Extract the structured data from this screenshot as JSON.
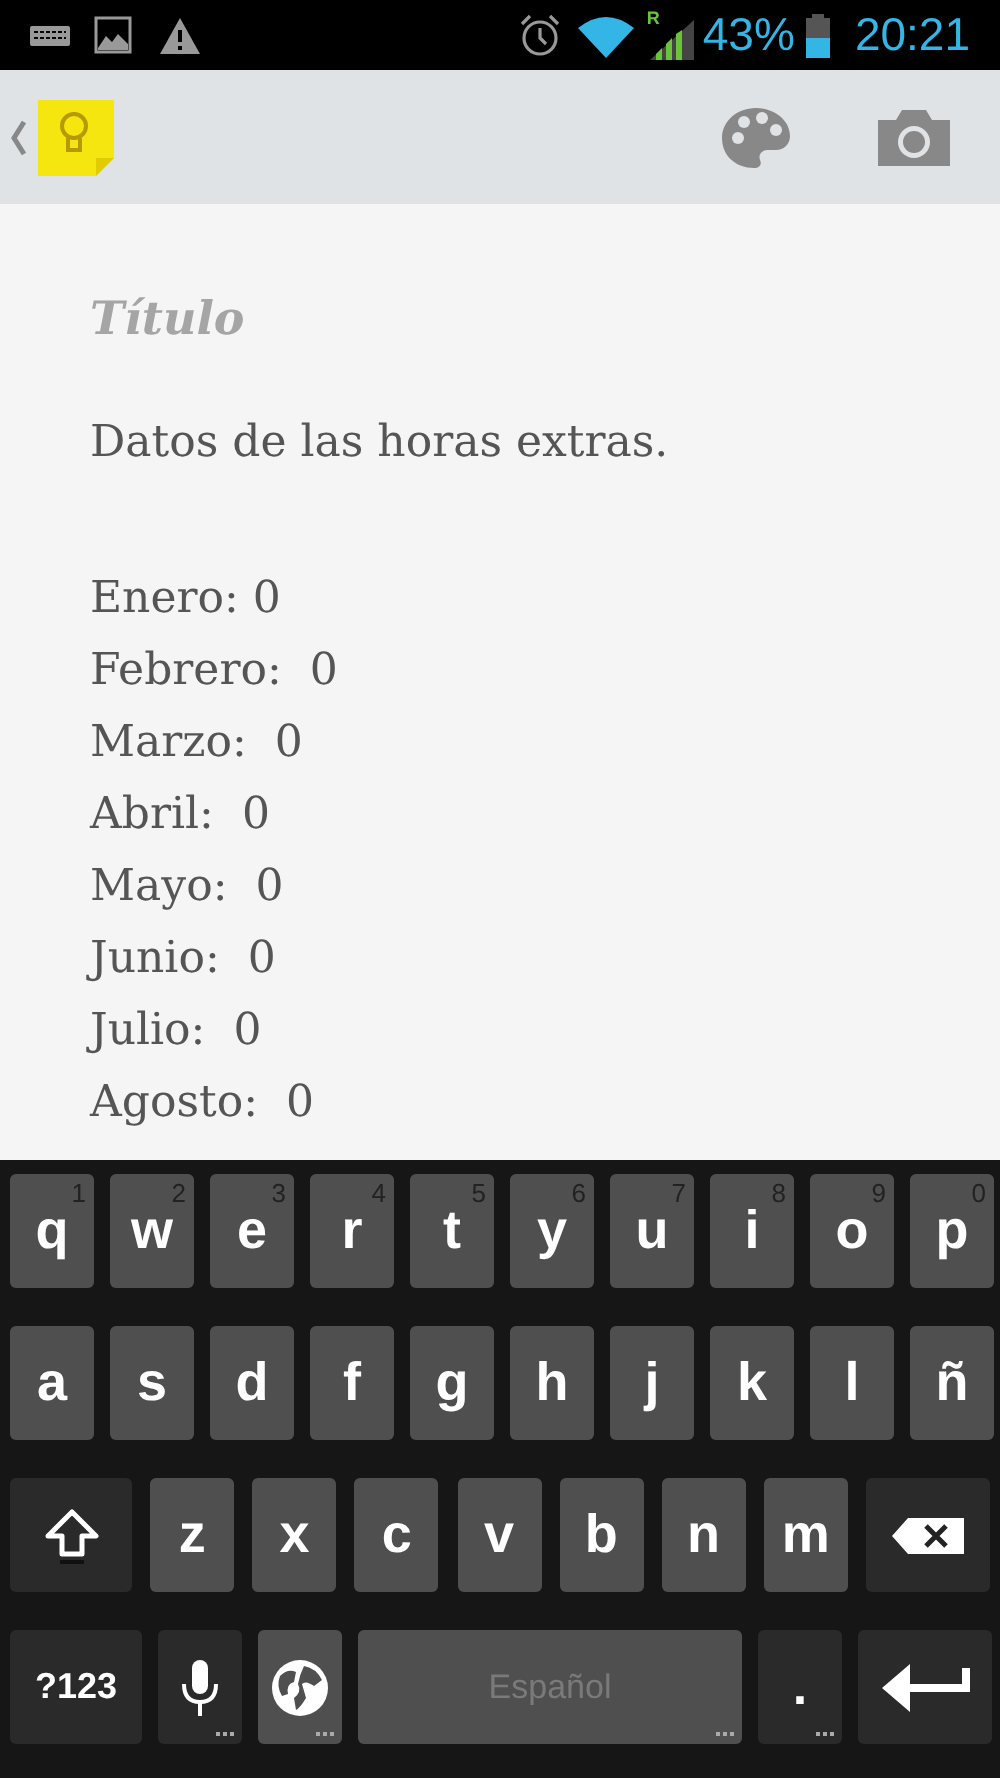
{
  "status_bar": {
    "roaming": "R",
    "battery": "43%",
    "time": "20:21"
  },
  "note": {
    "title_placeholder": "Título",
    "intro": "Datos de las horas extras.",
    "lines": [
      "Enero: 0",
      "Febrero:  0",
      "Marzo:  0",
      "Abril:  0",
      "Mayo:  0",
      "Junio:  0",
      "Julio:  0",
      "Agosto:  0"
    ]
  },
  "keyboard": {
    "key_rows": [
      [
        {
          "kind": "char",
          "label": "q",
          "hint": "1"
        },
        {
          "kind": "char",
          "label": "w",
          "hint": "2"
        },
        {
          "kind": "char",
          "label": "e",
          "hint": "3"
        },
        {
          "kind": "char",
          "label": "r",
          "hint": "4"
        },
        {
          "kind": "char",
          "label": "t",
          "hint": "5"
        },
        {
          "kind": "char",
          "label": "y",
          "hint": "6"
        },
        {
          "kind": "char",
          "label": "u",
          "hint": "7"
        },
        {
          "kind": "char",
          "label": "i",
          "hint": "8"
        },
        {
          "kind": "char",
          "label": "o",
          "hint": "9"
        },
        {
          "kind": "char",
          "label": "p",
          "hint": "0"
        }
      ],
      [
        {
          "kind": "char",
          "label": "a"
        },
        {
          "kind": "char",
          "label": "s"
        },
        {
          "kind": "char",
          "label": "d"
        },
        {
          "kind": "char",
          "label": "f"
        },
        {
          "kind": "char",
          "label": "g"
        },
        {
          "kind": "char",
          "label": "h"
        },
        {
          "kind": "char",
          "label": "j"
        },
        {
          "kind": "char",
          "label": "k"
        },
        {
          "kind": "char",
          "label": "l"
        },
        {
          "kind": "char",
          "label": "ñ"
        }
      ],
      [
        {
          "kind": "shift"
        },
        {
          "kind": "char",
          "label": "z"
        },
        {
          "kind": "char",
          "label": "x"
        },
        {
          "kind": "char",
          "label": "c"
        },
        {
          "kind": "char",
          "label": "v"
        },
        {
          "kind": "char",
          "label": "b"
        },
        {
          "kind": "char",
          "label": "n"
        },
        {
          "kind": "char",
          "label": "m"
        },
        {
          "kind": "backspace"
        }
      ],
      [
        {
          "kind": "mode",
          "label": "?123"
        },
        {
          "kind": "mic",
          "more": true
        },
        {
          "kind": "globe",
          "more": true
        },
        {
          "kind": "space",
          "label": "Español",
          "more": true
        },
        {
          "kind": "period",
          "label": ".",
          "more": true
        },
        {
          "kind": "enter"
        }
      ]
    ]
  }
}
